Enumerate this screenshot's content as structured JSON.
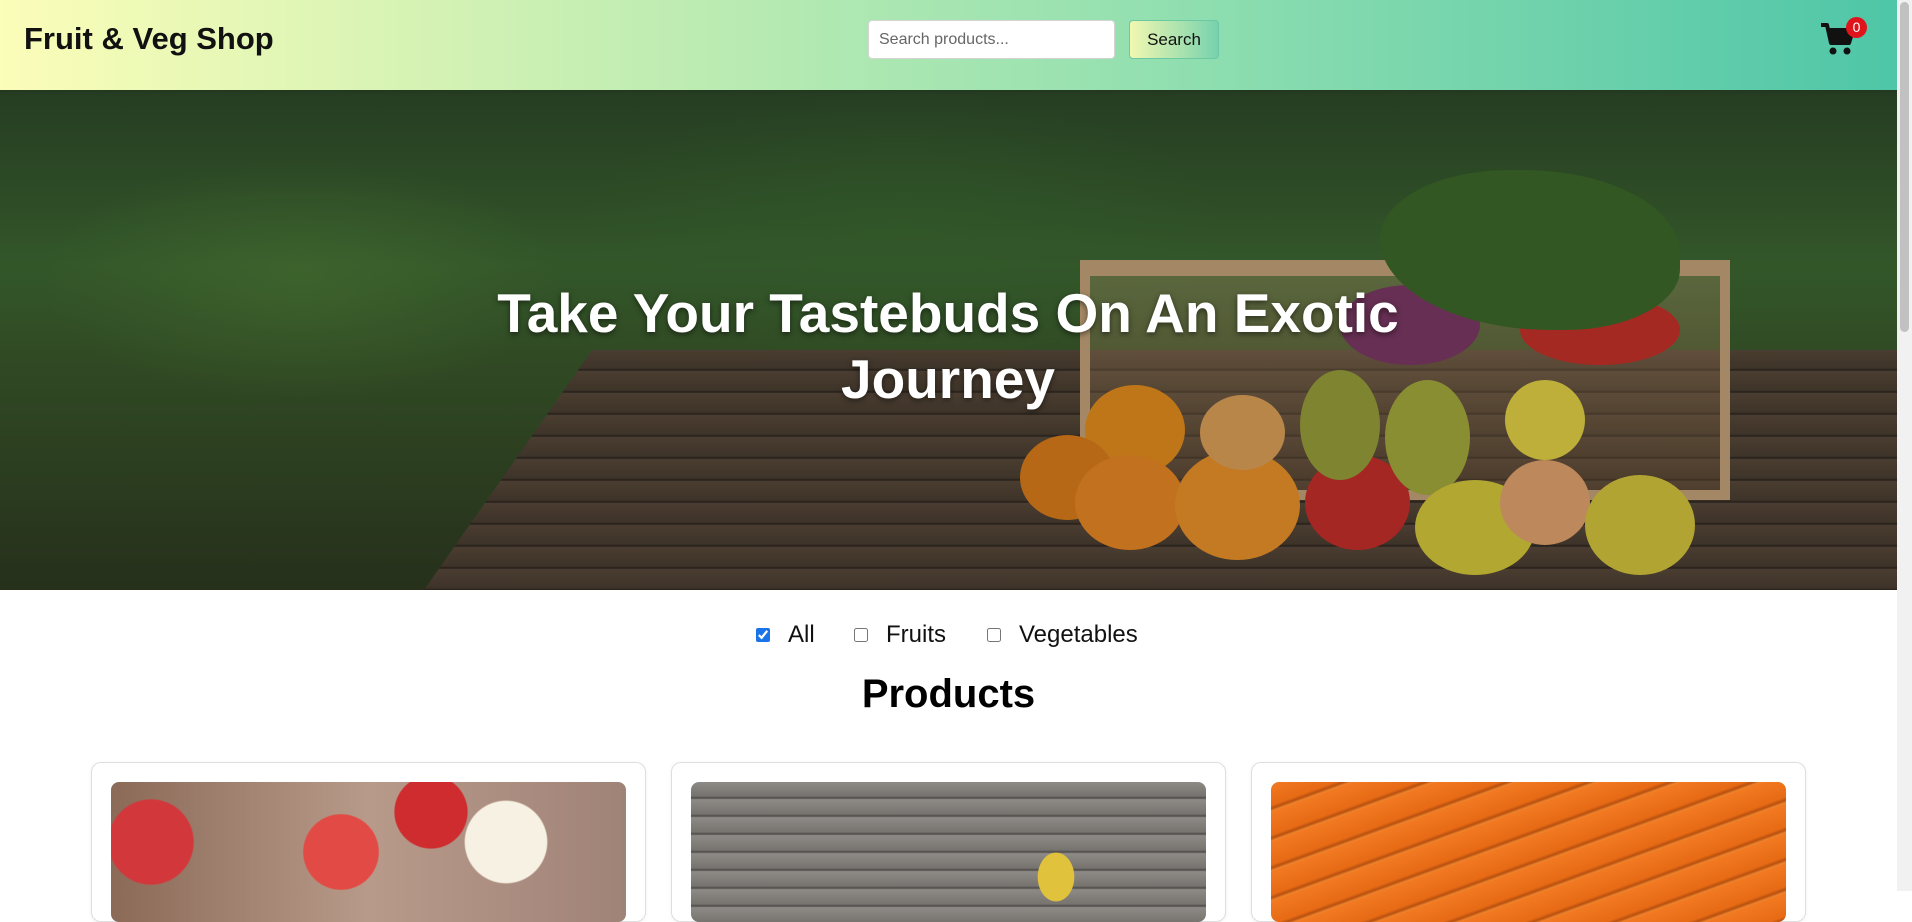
{
  "header": {
    "brand": "Fruit & Veg Shop",
    "search_placeholder": "Search products...",
    "search_button": "Search",
    "cart_count": "0",
    "colors": {
      "gradient_start": "#fbfdb8",
      "gradient_end": "#4fc6a8",
      "badge": "#e0151b"
    }
  },
  "hero": {
    "title": "Take Your Tastebuds On An Exotic Journey"
  },
  "filters": [
    {
      "label": "All",
      "checked": true
    },
    {
      "label": "Fruits",
      "checked": false
    },
    {
      "label": "Vegetables",
      "checked": false
    }
  ],
  "products": {
    "heading": "Products",
    "items": [
      {
        "image": "apples"
      },
      {
        "image": "bananas"
      },
      {
        "image": "carrots"
      }
    ]
  }
}
